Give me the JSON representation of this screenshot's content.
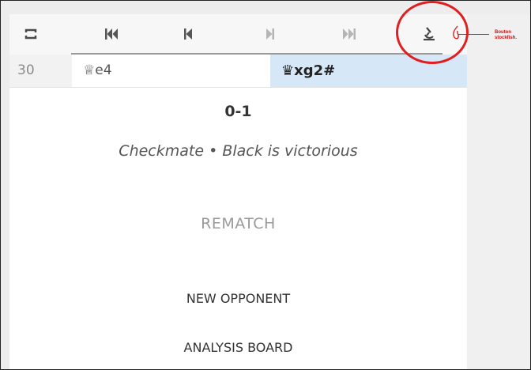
{
  "toolbar": {
    "buttons": [
      {
        "icon": "flip-board-icon"
      },
      {
        "icon": "first-move-icon"
      },
      {
        "icon": "previous-move-icon"
      },
      {
        "icon": "next-move-icon"
      },
      {
        "icon": "last-move-icon"
      },
      {
        "icon": "stockfish-analysis-icon"
      }
    ]
  },
  "moves": {
    "number": "30",
    "white": "♕e4",
    "black": "♛xg2#"
  },
  "result": {
    "score": "0-1",
    "status": "Checkmate • Black is victorious"
  },
  "actions": {
    "rematch": "REMATCH",
    "new_opponent": "NEW OPPONENT",
    "analysis_board": "ANALYSIS BOARD"
  },
  "annotation": {
    "label": "Bouton stockfish."
  },
  "colors": {
    "highlight": "#d6e8f8",
    "annotation_red": "#e02020"
  }
}
